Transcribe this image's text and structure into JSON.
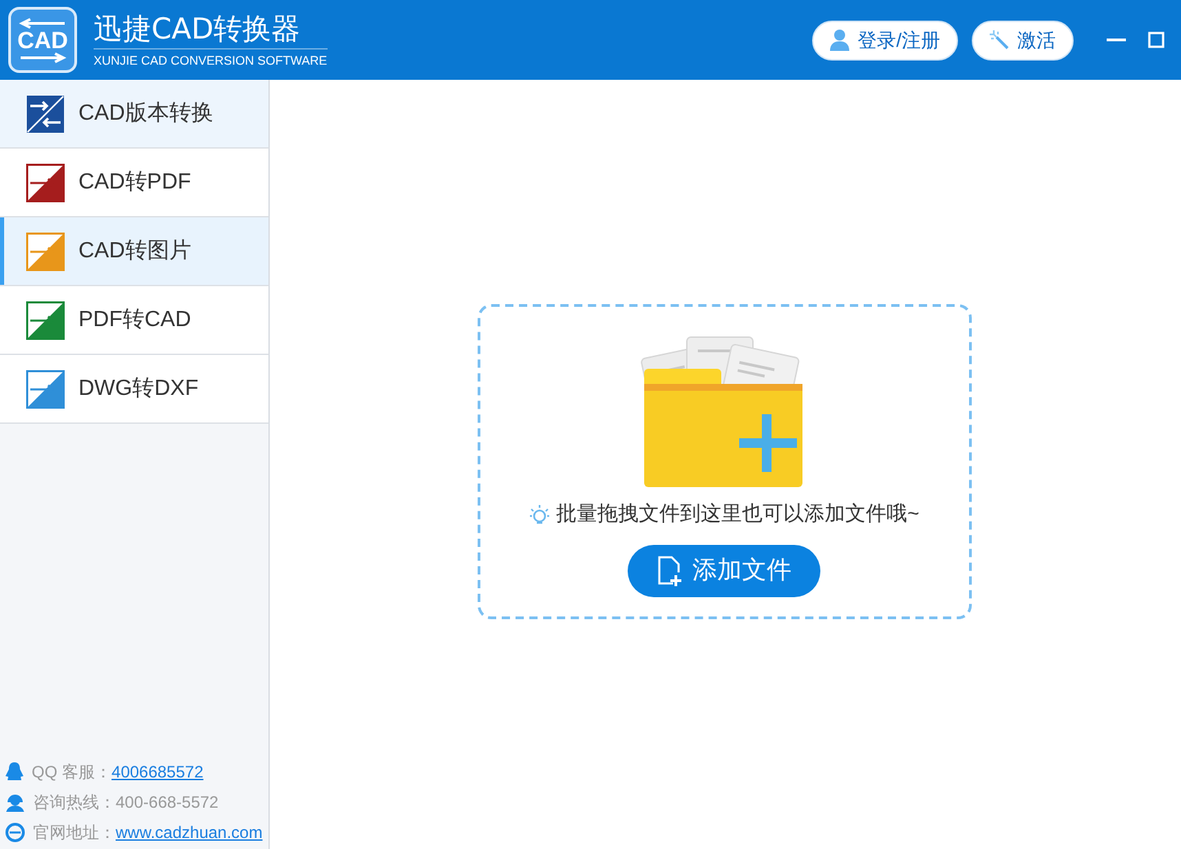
{
  "app": {
    "title": "迅捷CAD转换器",
    "subtitle": "XUNJIE CAD CONVERSION SOFTWARE",
    "logo_text": "CAD"
  },
  "header_buttons": [
    {
      "kind": "login",
      "label": "登录/注册"
    },
    {
      "kind": "activate",
      "label": "激活"
    }
  ],
  "sidebar": {
    "items": [
      {
        "label": "CAD版本转换",
        "kind": "version",
        "selected": false,
        "hovered": true
      },
      {
        "label": "CAD转PDF",
        "kind": "pdf",
        "selected": false,
        "hovered": false
      },
      {
        "label": "CAD转图片",
        "kind": "image",
        "selected": true,
        "hovered": false
      },
      {
        "label": "PDF转CAD",
        "kind": "pdf2cad",
        "selected": false,
        "hovered": false
      },
      {
        "label": "DWG转DXF",
        "kind": "dwg",
        "selected": false,
        "hovered": false
      }
    ],
    "contacts": [
      {
        "kind": "qq",
        "label": "QQ 客服：",
        "value": "4006685572",
        "link": true
      },
      {
        "kind": "phone",
        "label": "咨询热线：",
        "value": "400-668-5572",
        "link": false
      },
      {
        "kind": "web",
        "label": "官网地址：",
        "value": "www.cadzhuan.com",
        "link": true
      }
    ]
  },
  "drop_zone": {
    "hint": "批量拖拽文件到这里也可以添加文件哦~",
    "button": "添加文件"
  }
}
